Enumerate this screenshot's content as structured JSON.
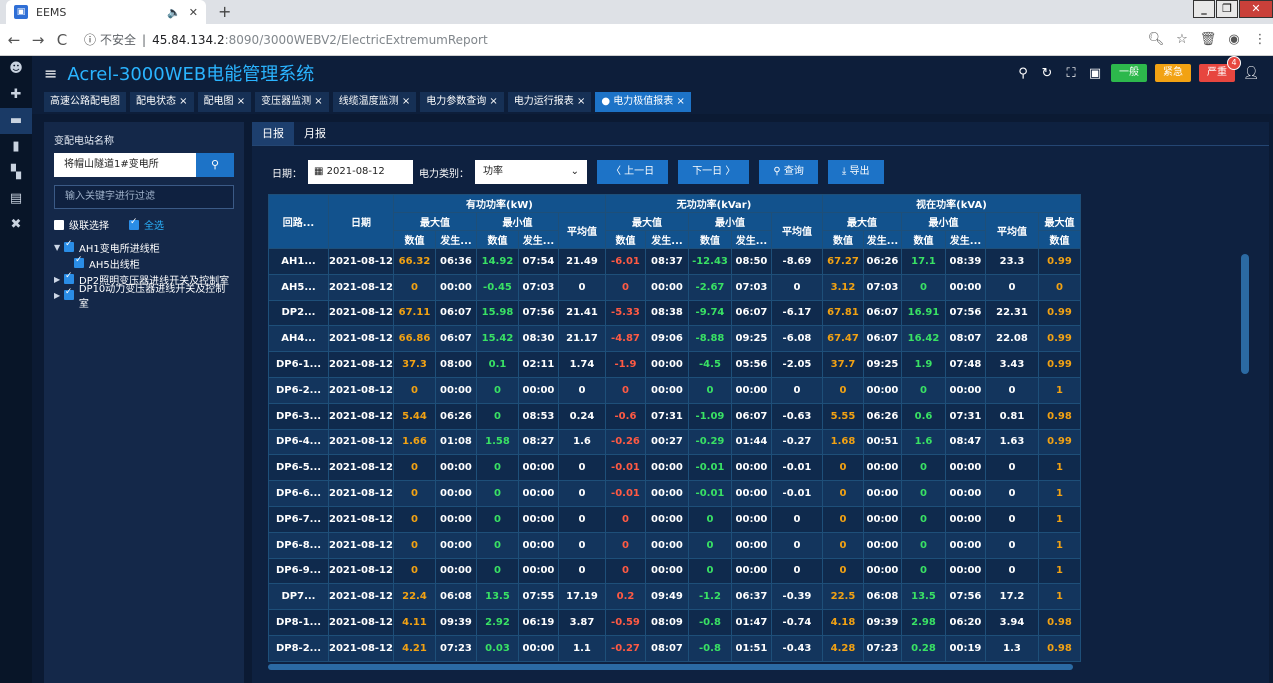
{
  "browser": {
    "tab_title": "EEMS",
    "tab_close": "✕",
    "new_tab": "+",
    "back": "←",
    "forward": "→",
    "reload": "C",
    "insecure_label": "不安全",
    "url_host": "45.84.134.2",
    "url_rest": ":8090/3000WEBV2/ElectricExtremumReport"
  },
  "app": {
    "title": "Acrel-3000WEB电能管理系统",
    "alarm_normal": "一般",
    "alarm_urgent": "紧急",
    "alarm_severe": "严重",
    "alarm_severe_count": "4"
  },
  "page_tabs": [
    {
      "label": "高速公路配电图"
    },
    {
      "label": "配电状态 ×"
    },
    {
      "label": "配电图 ×"
    },
    {
      "label": "变压器监测 ×"
    },
    {
      "label": "线缆温度监测 ×"
    },
    {
      "label": "电力参数查询 ×"
    },
    {
      "label": "电力运行报表 ×"
    },
    {
      "label": "● 电力极值报表 ×"
    }
  ],
  "sidebar": {
    "station_label": "变配电站名称",
    "station_value": "将帽山隧道1#变电所",
    "filter_placeholder": "输入关键字进行过滤",
    "cascade_label": "级联选择",
    "select_all_label": "全选",
    "tree": [
      {
        "label": "AH1变电所进线柜",
        "expanded": true
      },
      {
        "label": "AH5出线柜",
        "child": true
      },
      {
        "label": "DP2照明变压器进线开关及控制室"
      },
      {
        "label": "DP10动力变压器进线开关及控制室"
      }
    ]
  },
  "report": {
    "tab_daily": "日报",
    "tab_monthly": "月报",
    "date_label": "日期：",
    "date_value": "2021-08-12",
    "type_label": "电力类别：",
    "type_value": "功率",
    "prev_day": "〈 上一日",
    "next_day": "下一日 〉",
    "query": "查询",
    "export": "导出"
  },
  "table": {
    "h_circuit": "回路...",
    "h_date": "日期",
    "h_active": "有功功率(kW)",
    "h_reactive": "无功功率(kVar)",
    "h_apparent": "视在功率(kVA)",
    "h_max": "最大值",
    "h_min": "最小值",
    "h_avg": "平均值",
    "h_value": "数值",
    "h_time": "发生...",
    "rows": [
      [
        "AH1...",
        "2021-08-12",
        "66.32",
        "06:36",
        "14.92",
        "07:54",
        "21.49",
        "-6.01",
        "08:37",
        "-12.43",
        "08:50",
        "-8.69",
        "67.27",
        "06:26",
        "17.1",
        "08:39",
        "23.3",
        "0.99"
      ],
      [
        "AH5...",
        "2021-08-12",
        "0",
        "00:00",
        "-0.45",
        "07:03",
        "0",
        "0",
        "00:00",
        "-2.67",
        "07:03",
        "0",
        "3.12",
        "07:03",
        "0",
        "00:00",
        "0",
        "0"
      ],
      [
        "DP2...",
        "2021-08-12",
        "67.11",
        "06:07",
        "15.98",
        "07:56",
        "21.41",
        "-5.33",
        "08:38",
        "-9.74",
        "06:07",
        "-6.17",
        "67.81",
        "06:07",
        "16.91",
        "07:56",
        "22.31",
        "0.99"
      ],
      [
        "AH4...",
        "2021-08-12",
        "66.86",
        "06:07",
        "15.42",
        "08:30",
        "21.17",
        "-4.87",
        "09:06",
        "-8.88",
        "09:25",
        "-6.08",
        "67.47",
        "06:07",
        "16.42",
        "08:07",
        "22.08",
        "0.99"
      ],
      [
        "DP6-1...",
        "2021-08-12",
        "37.3",
        "08:00",
        "0.1",
        "02:11",
        "1.74",
        "-1.9",
        "00:00",
        "-4.5",
        "05:56",
        "-2.05",
        "37.7",
        "09:25",
        "1.9",
        "07:48",
        "3.43",
        "0.99"
      ],
      [
        "DP6-2...",
        "2021-08-12",
        "0",
        "00:00",
        "0",
        "00:00",
        "0",
        "0",
        "00:00",
        "0",
        "00:00",
        "0",
        "0",
        "00:00",
        "0",
        "00:00",
        "0",
        "1"
      ],
      [
        "DP6-3...",
        "2021-08-12",
        "5.44",
        "06:26",
        "0",
        "08:53",
        "0.24",
        "-0.6",
        "07:31",
        "-1.09",
        "06:07",
        "-0.63",
        "5.55",
        "06:26",
        "0.6",
        "07:31",
        "0.81",
        "0.98"
      ],
      [
        "DP6-4...",
        "2021-08-12",
        "1.66",
        "01:08",
        "1.58",
        "08:27",
        "1.6",
        "-0.26",
        "00:27",
        "-0.29",
        "01:44",
        "-0.27",
        "1.68",
        "00:51",
        "1.6",
        "08:47",
        "1.63",
        "0.99"
      ],
      [
        "DP6-5...",
        "2021-08-12",
        "0",
        "00:00",
        "0",
        "00:00",
        "0",
        "-0.01",
        "00:00",
        "-0.01",
        "00:00",
        "-0.01",
        "0",
        "00:00",
        "0",
        "00:00",
        "0",
        "1"
      ],
      [
        "DP6-6...",
        "2021-08-12",
        "0",
        "00:00",
        "0",
        "00:00",
        "0",
        "-0.01",
        "00:00",
        "-0.01",
        "00:00",
        "-0.01",
        "0",
        "00:00",
        "0",
        "00:00",
        "0",
        "1"
      ],
      [
        "DP6-7...",
        "2021-08-12",
        "0",
        "00:00",
        "0",
        "00:00",
        "0",
        "0",
        "00:00",
        "0",
        "00:00",
        "0",
        "0",
        "00:00",
        "0",
        "00:00",
        "0",
        "1"
      ],
      [
        "DP6-8...",
        "2021-08-12",
        "0",
        "00:00",
        "0",
        "00:00",
        "0",
        "0",
        "00:00",
        "0",
        "00:00",
        "0",
        "0",
        "00:00",
        "0",
        "00:00",
        "0",
        "1"
      ],
      [
        "DP6-9...",
        "2021-08-12",
        "0",
        "00:00",
        "0",
        "00:00",
        "0",
        "0",
        "00:00",
        "0",
        "00:00",
        "0",
        "0",
        "00:00",
        "0",
        "00:00",
        "0",
        "1"
      ],
      [
        "DP7...",
        "2021-08-12",
        "22.4",
        "06:08",
        "13.5",
        "07:55",
        "17.19",
        "0.2",
        "09:49",
        "-1.2",
        "06:37",
        "-0.39",
        "22.5",
        "06:08",
        "13.5",
        "07:56",
        "17.2",
        "1"
      ],
      [
        "DP8-1...",
        "2021-08-12",
        "4.11",
        "09:39",
        "2.92",
        "06:19",
        "3.87",
        "-0.59",
        "08:09",
        "-0.8",
        "01:47",
        "-0.74",
        "4.18",
        "09:39",
        "2.98",
        "06:20",
        "3.94",
        "0.98"
      ],
      [
        "DP8-2...",
        "2021-08-12",
        "4.21",
        "07:23",
        "0.03",
        "00:00",
        "1.1",
        "-0.27",
        "08:07",
        "-0.8",
        "01:51",
        "-0.43",
        "4.28",
        "07:23",
        "0.28",
        "00:19",
        "1.3",
        "0.98"
      ]
    ]
  }
}
